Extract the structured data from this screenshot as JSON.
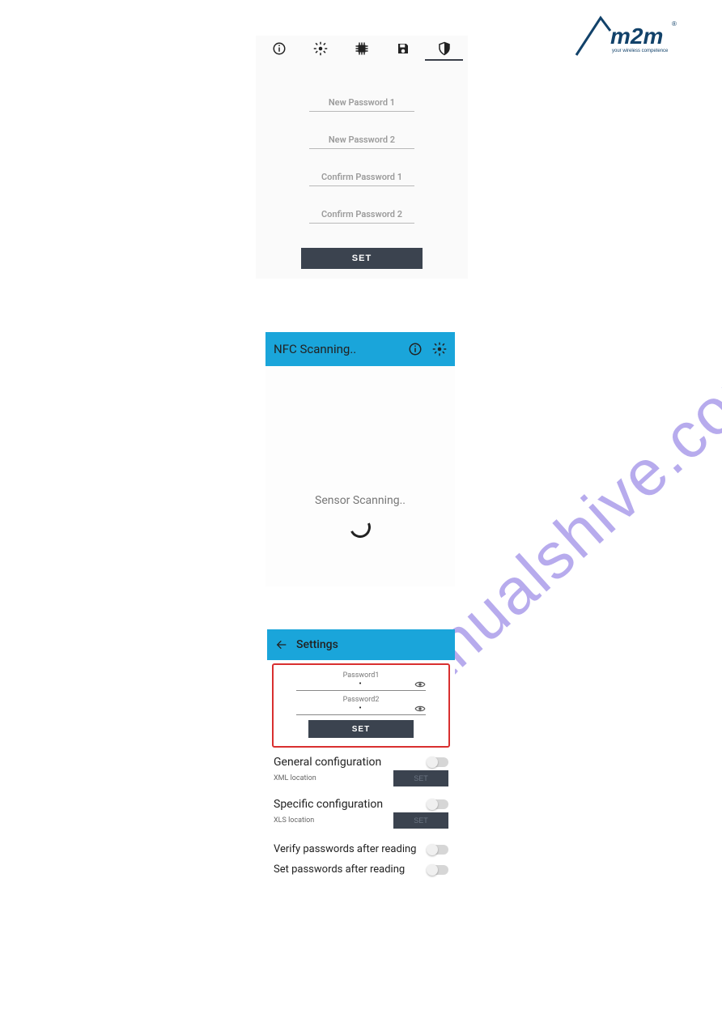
{
  "watermark": "manualshive.com",
  "logo": {
    "brand_main": "m2m",
    "brand_sub": "your wireless competence",
    "reg_mark": "®"
  },
  "screen1": {
    "tabs": {
      "info_icon": "info",
      "gear_icon": "gear",
      "chip_icon": "chip",
      "save_icon": "save",
      "shield_icon": "shield"
    },
    "fields": {
      "new_pw1": "New Password 1",
      "new_pw2": "New Password 2",
      "confirm_pw1": "Confirm Password 1",
      "confirm_pw2": "Confirm Password 2"
    },
    "set_button": "SET"
  },
  "screen2": {
    "title": "NFC Scanning..",
    "sensor_text": "Sensor Scanning.."
  },
  "screen3": {
    "title": "Settings",
    "pw1_label": "Password1",
    "pw2_label": "Password2",
    "pw_value": "•",
    "set_button": "SET",
    "general_cfg": "General configuration",
    "xml_label": "XML location",
    "xml_btn": "SET",
    "specific_cfg": "Specific configuration",
    "xls_label": "XLS location",
    "xls_btn": "SET",
    "verify_row": "Verify passwords after reading",
    "setpw_row": "Set passwords after reading"
  }
}
